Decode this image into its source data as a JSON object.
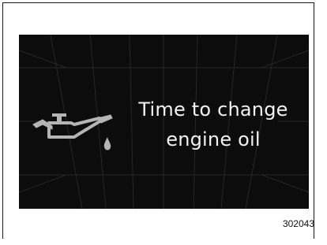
{
  "display": {
    "message_line1": "Time to change",
    "message_line2": "engine oil",
    "icon": "oil-can-icon",
    "colors": {
      "background": "#0c0c0c",
      "text": "#f2f2f2",
      "icon": "#b5b5b5"
    }
  },
  "figure": {
    "id": "302043"
  }
}
